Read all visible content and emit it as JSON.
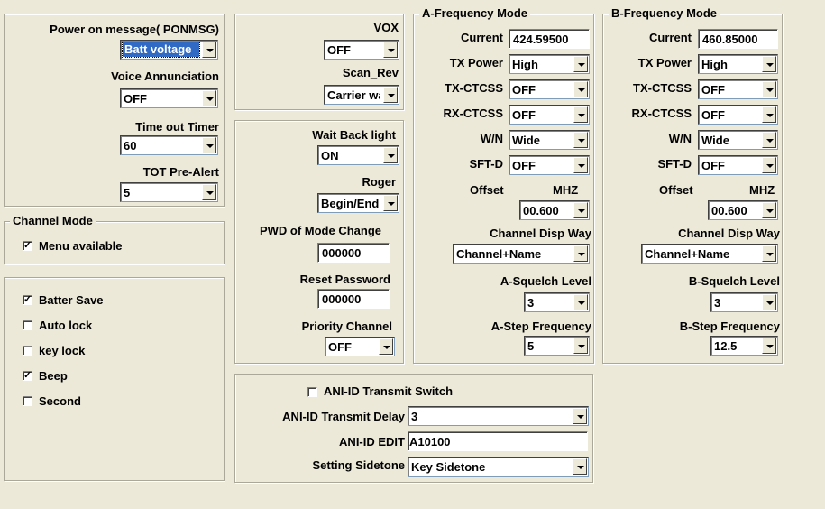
{
  "power": {
    "ponmsg_label": "Power on message( PONMSG)",
    "ponmsg_value": "Batt voltage",
    "voice_label": "Voice Annunciation",
    "voice_value": "OFF",
    "tot_label": "Time out Timer",
    "tot_value": "60",
    "prealert_label": "TOT Pre-Alert",
    "prealert_value": "5"
  },
  "channel_mode": {
    "title": "Channel Mode",
    "menu_label": "Menu available",
    "menu_checked": true
  },
  "options": {
    "batter_save": "Batter Save",
    "auto_lock": "Auto lock",
    "key_lock": "key lock",
    "beep": "Beep",
    "second": "Second"
  },
  "vox": {
    "vox_label": "VOX",
    "vox_value": "OFF",
    "scan_label": "Scan_Rev",
    "scan_value": "Carrier wa"
  },
  "misc": {
    "backlight_label": "Wait Back light",
    "backlight_value": "ON",
    "roger_label": "Roger",
    "roger_value": "Begin/End",
    "pwd_label": "PWD of Mode Change",
    "pwd_value": "000000",
    "reset_label": "Reset Password",
    "reset_value": "000000",
    "priority_label": "Priority Channel",
    "priority_value": "OFF"
  },
  "a_freq": {
    "title": "A-Frequency Mode",
    "current_label": "Current",
    "current_value": "424.59500",
    "txpower_label": "TX Power",
    "txpower_value": "High",
    "txctcss_label": "TX-CTCSS",
    "txctcss_value": "OFF",
    "rxctcss_label": "RX-CTCSS",
    "rxctcss_value": "OFF",
    "wn_label": "W/N",
    "wn_value": "Wide",
    "sftd_label": "SFT-D",
    "sftd_value": "OFF",
    "offset_label": "Offset",
    "mhz_label": "MHZ",
    "offset_value": "00.600",
    "disp_label": "Channel Disp Way",
    "disp_value": "Channel+Name",
    "squelch_label": "A-Squelch Level",
    "squelch_value": "3",
    "step_label": "A-Step Frequency",
    "step_value": "5"
  },
  "b_freq": {
    "title": "B-Frequency Mode",
    "current_label": "Current",
    "current_value": "460.85000",
    "txpower_label": "TX Power",
    "txpower_value": "High",
    "txctcss_label": "TX-CTCSS",
    "txctcss_value": "OFF",
    "rxctcss_label": "RX-CTCSS",
    "rxctcss_value": "OFF",
    "wn_label": "W/N",
    "wn_value": "Wide",
    "sftd_label": "SFT-D",
    "sftd_value": "OFF",
    "offset_label": "Offset",
    "mhz_label": "MHZ",
    "offset_value": "00.600",
    "disp_label": "Channel Disp Way",
    "disp_value": "Channel+Name",
    "squelch_label": "B-Squelch Level",
    "squelch_value": "3",
    "step_label": "B-Step Frequency",
    "step_value": "12.5"
  },
  "ani": {
    "switch_label": "ANI-ID Transmit Switch",
    "delay_label": "ANI-ID  Transmit Delay",
    "delay_value": "3",
    "edit_label": "ANI-ID EDIT",
    "edit_value": "A10100",
    "sidetone_label": "Setting Sidetone",
    "sidetone_value": "Key Sidetone"
  }
}
